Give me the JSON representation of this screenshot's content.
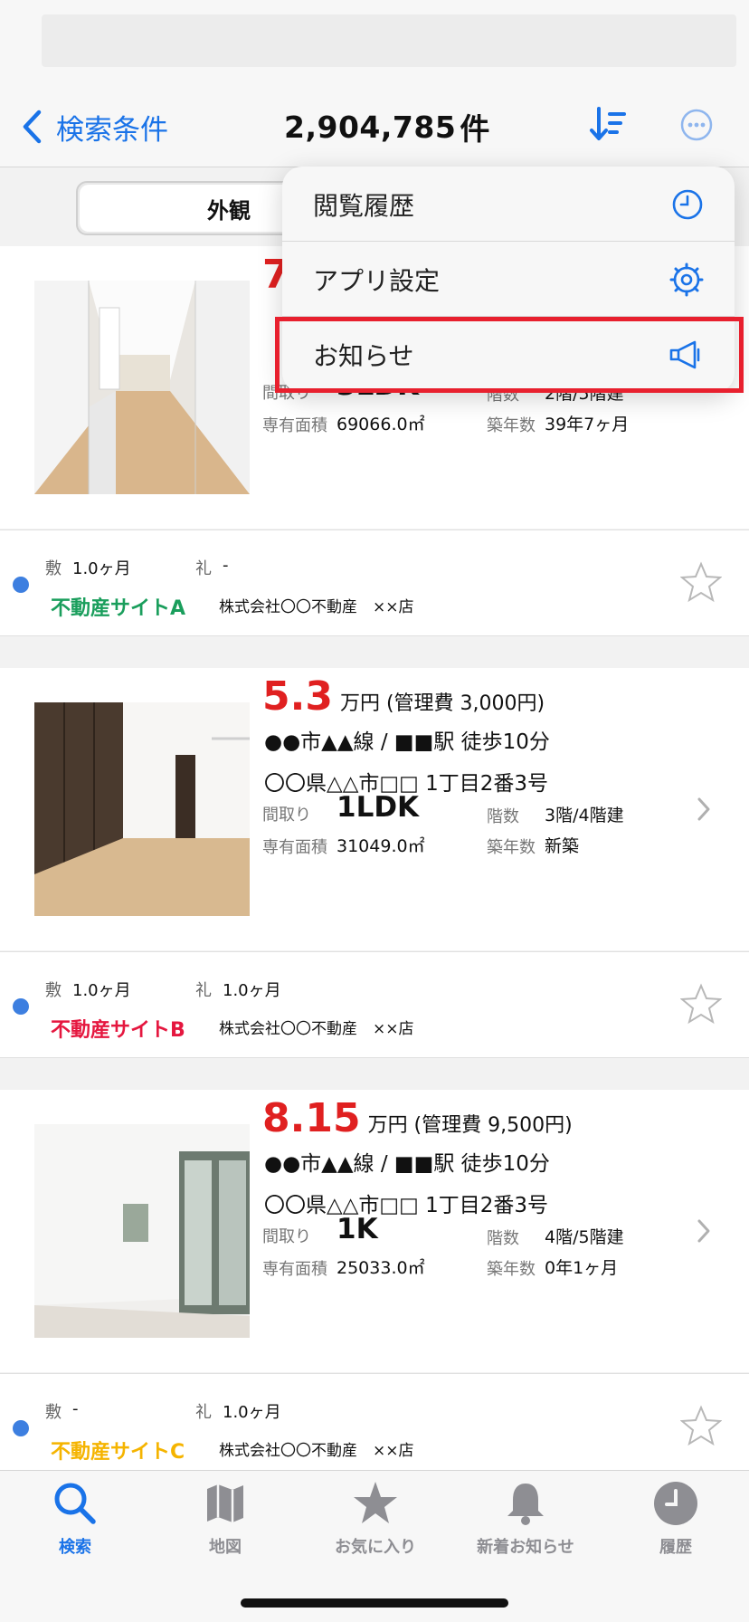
{
  "header": {
    "back_label": "検索条件",
    "result_count": "2,904,785",
    "result_unit": "件"
  },
  "segment": {
    "active_label": "外観"
  },
  "menu": {
    "items": [
      {
        "label": "閲覧履歴",
        "icon": "clock-icon"
      },
      {
        "label": "アプリ設定",
        "icon": "gear-icon"
      },
      {
        "label": "お知らせ",
        "icon": "megaphone-icon",
        "highlighted": true
      }
    ]
  },
  "listings": [
    {
      "price_partial": "7",
      "layout_label": "間取り",
      "layout": "3LDK",
      "floor_label": "階数",
      "floor": "2階/5階建",
      "area_label": "専有面積",
      "area": "69066.0㎡",
      "age_label": "築年数",
      "age": "39年7ヶ月",
      "deposit_label": "敷",
      "deposit": "1.0ヶ月",
      "key_money_label": "礼",
      "key_money": "-",
      "site": "不動産サイトA",
      "site_color": "#1a9e5c",
      "company": "株式会社〇〇不動産　××店"
    },
    {
      "price": "5.3",
      "price_unit": "万円 (管理費 3,000円)",
      "station": "●●市▲▲線 / ■■駅 徒歩10分",
      "address": "〇〇県△△市□□ 1丁目2番3号",
      "layout_label": "間取り",
      "layout": "1LDK",
      "floor_label": "階数",
      "floor": "3階/4階建",
      "area_label": "専有面積",
      "area": "31049.0㎡",
      "age_label": "築年数",
      "age": "新築",
      "deposit_label": "敷",
      "deposit": "1.0ヶ月",
      "key_money_label": "礼",
      "key_money": "1.0ヶ月",
      "site": "不動産サイトB",
      "site_color": "#e5173f",
      "company": "株式会社〇〇不動産　××店"
    },
    {
      "price": "8.15",
      "price_unit": "万円 (管理費 9,500円)",
      "station": "●●市▲▲線 / ■■駅 徒歩10分",
      "address": "〇〇県△△市□□ 1丁目2番3号",
      "layout_label": "間取り",
      "layout": "1K",
      "floor_label": "階数",
      "floor": "4階/5階建",
      "area_label": "専有面積",
      "area": "25033.0㎡",
      "age_label": "築年数",
      "age": "0年1ヶ月",
      "deposit_label": "敷",
      "deposit": "-",
      "key_money_label": "礼",
      "key_money": "1.0ヶ月",
      "site": "不動産サイトC",
      "site_color": "#f5b400",
      "company": "株式会社〇〇不動産　××店"
    }
  ],
  "tabs": [
    {
      "label": "検索",
      "icon": "search-icon",
      "active": true
    },
    {
      "label": "地図",
      "icon": "map-icon"
    },
    {
      "label": "お気に入り",
      "icon": "star-icon"
    },
    {
      "label": "新着お知らせ",
      "icon": "bell-icon"
    },
    {
      "label": "履歴",
      "icon": "history-clock-icon"
    }
  ],
  "colors": {
    "accent": "#1a73e8",
    "price": "#e02020",
    "highlight": "#e8202e"
  }
}
